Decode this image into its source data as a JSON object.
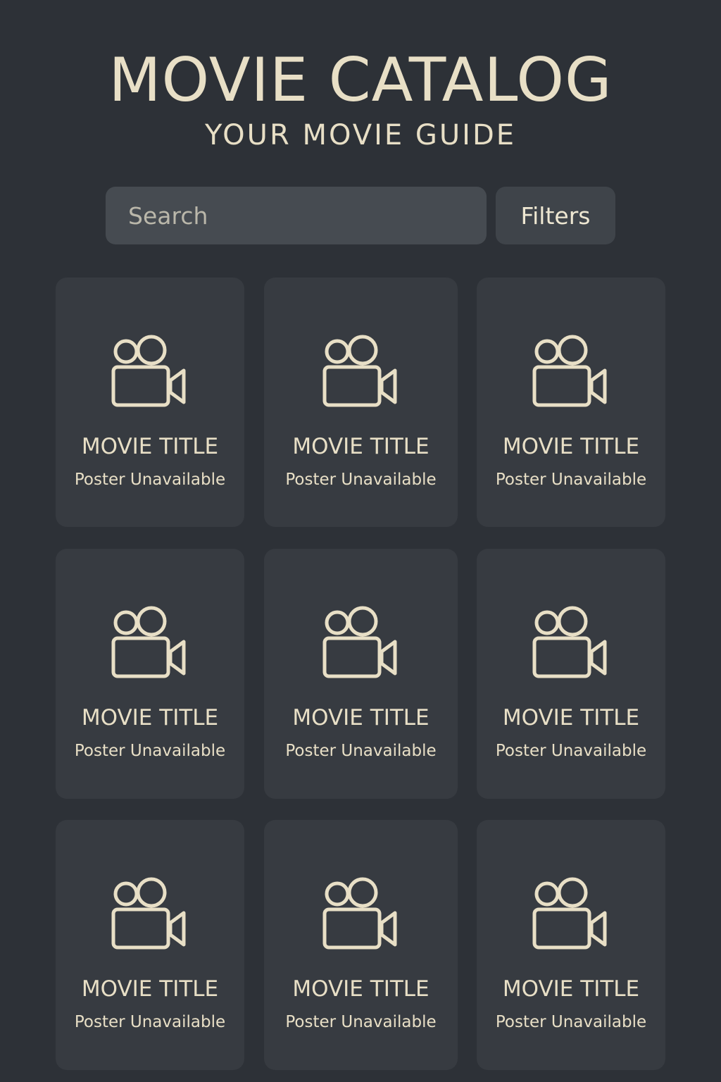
{
  "header": {
    "title": "MOVIE CATALOG",
    "subtitle": "YOUR MOVIE GUIDE"
  },
  "search": {
    "placeholder": "Search",
    "value": "",
    "filters_label": "Filters"
  },
  "movies": [
    {
      "title": "MOVIE TITLE",
      "status": "Poster Unavailable",
      "icon": "movie-camera-icon"
    },
    {
      "title": "MOVIE TITLE",
      "status": "Poster Unavailable",
      "icon": "movie-camera-icon"
    },
    {
      "title": "MOVIE TITLE",
      "status": "Poster Unavailable",
      "icon": "movie-camera-icon"
    },
    {
      "title": "MOVIE TITLE",
      "status": "Poster Unavailable",
      "icon": "movie-camera-icon"
    },
    {
      "title": "MOVIE TITLE",
      "status": "Poster Unavailable",
      "icon": "movie-camera-icon"
    },
    {
      "title": "MOVIE TITLE",
      "status": "Poster Unavailable",
      "icon": "movie-camera-icon"
    },
    {
      "title": "MOVIE TITLE",
      "status": "Poster Unavailable",
      "icon": "movie-camera-icon"
    },
    {
      "title": "MOVIE TITLE",
      "status": "Poster Unavailable",
      "icon": "movie-camera-icon"
    },
    {
      "title": "MOVIE TITLE",
      "status": "Poster Unavailable",
      "icon": "movie-camera-icon"
    }
  ],
  "colors": {
    "background": "#2d3137",
    "card": "#373b41",
    "accent": "#e8dfc6",
    "search_bg": "#464b51",
    "filters_bg": "#3f444a"
  }
}
